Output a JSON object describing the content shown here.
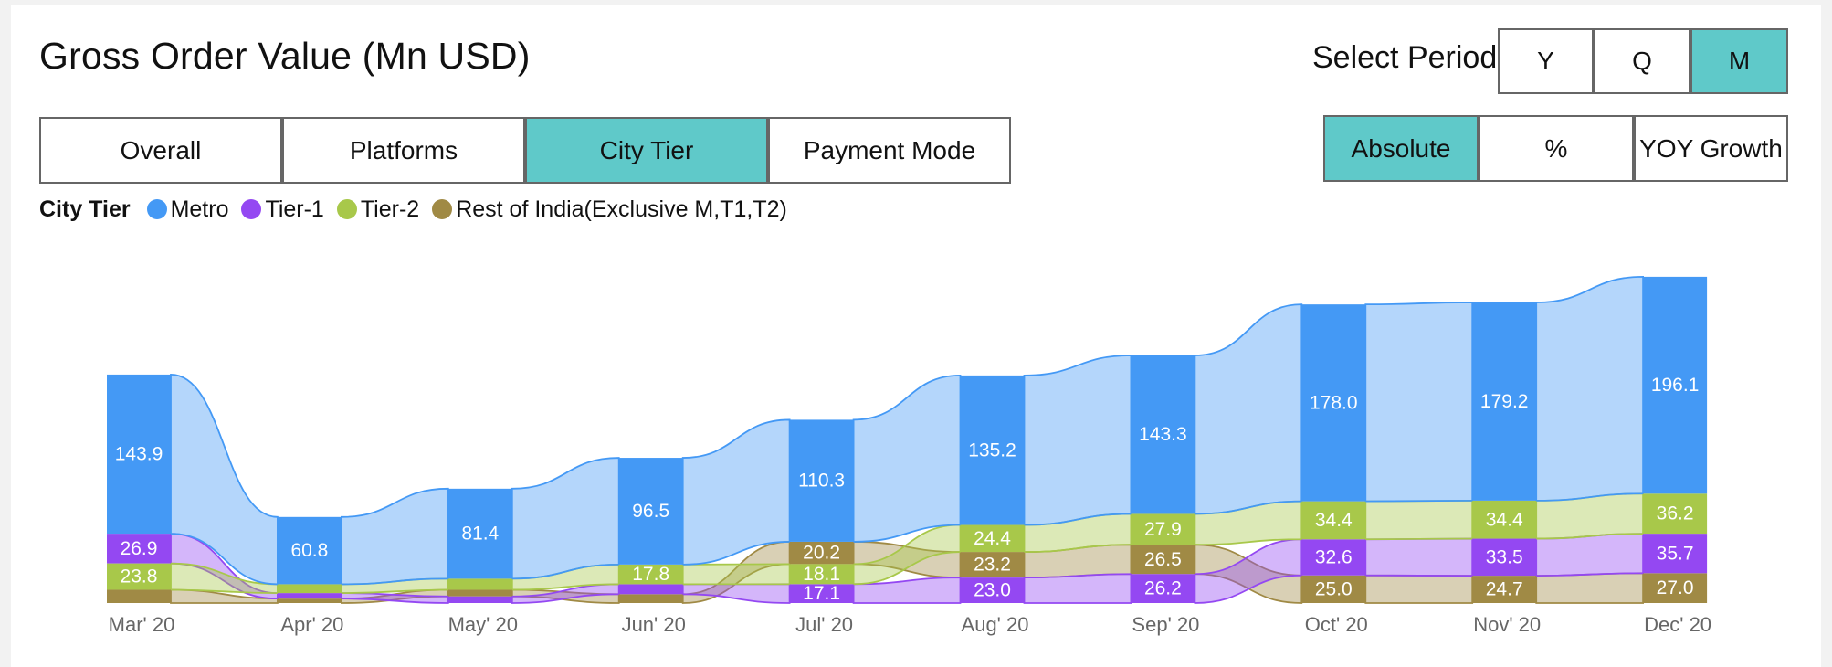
{
  "title": "Gross Order Value (Mn USD)",
  "period": {
    "label": "Select Period",
    "options": [
      "Y",
      "Q",
      "M"
    ],
    "active": "M"
  },
  "tabs": {
    "items": [
      "Overall",
      "Platforms",
      "City Tier",
      "Payment Mode"
    ],
    "active": "City Tier"
  },
  "modes": {
    "items": [
      "Absolute",
      "%",
      "YOY Growth"
    ],
    "active": "Absolute"
  },
  "legend": {
    "title": "City Tier"
  },
  "colors": {
    "metro": "#4499f5",
    "tier1": "#9448f2",
    "tier2": "#a8c84a",
    "rest": "#a08a45",
    "active_button": "#5fc9c9"
  },
  "chart_data": {
    "type": "bar",
    "stacked": true,
    "ribbons_between_bars": true,
    "categories": [
      "Mar' 20",
      "Apr' 20",
      "May' 20",
      "Jun' 20",
      "Jul' 20",
      "Aug' 20",
      "Sep' 20",
      "Oct' 20",
      "Nov' 20",
      "Dec' 20"
    ],
    "series": [
      {
        "name": "Rest of India(Exclusive M,T1,T2)",
        "values": [
          12.0,
          4.0,
          6.0,
          8.0,
          20.2,
          23.2,
          26.5,
          25.0,
          24.7,
          27.0
        ],
        "labels": [
          "",
          "",
          "",
          "",
          "20.2",
          "23.2",
          "26.5",
          "25.0",
          "24.7",
          "27.0"
        ]
      },
      {
        "name": "Tier-2",
        "values": [
          23.8,
          8.0,
          10.0,
          17.8,
          18.1,
          24.4,
          27.9,
          34.4,
          34.4,
          36.2
        ],
        "labels": [
          "23.8",
          "",
          "",
          "17.8",
          "18.1",
          "24.4",
          "27.9",
          "34.4",
          "34.4",
          "36.2"
        ]
      },
      {
        "name": "Tier-1",
        "values": [
          26.9,
          5.0,
          6.0,
          9.0,
          17.1,
          23.0,
          26.2,
          32.6,
          33.5,
          35.7
        ],
        "labels": [
          "26.9",
          "",
          "",
          "",
          "17.1",
          "23.0",
          "26.2",
          "32.6",
          "33.5",
          "35.7"
        ]
      },
      {
        "name": "Metro",
        "values": [
          143.9,
          60.8,
          81.4,
          96.5,
          110.3,
          135.2,
          143.3,
          178.0,
          179.2,
          196.1
        ],
        "labels": [
          "143.9",
          "60.8",
          "81.4",
          "96.5",
          "110.3",
          "135.2",
          "143.3",
          "178.0",
          "179.2",
          "196.1"
        ]
      }
    ],
    "tier_order_bottom_to_top": [
      [
        "Rest of India(Exclusive M,T1,T2)",
        "Tier-2",
        "Tier-1",
        "Metro"
      ],
      [
        "Rest of India(Exclusive M,T1,T2)",
        "Tier-1",
        "Tier-2",
        "Metro"
      ],
      [
        "Tier-1",
        "Rest of India(Exclusive M,T1,T2)",
        "Tier-2",
        "Metro"
      ],
      [
        "Rest of India(Exclusive M,T1,T2)",
        "Tier-1",
        "Tier-2",
        "Metro"
      ],
      [
        "Tier-1",
        "Tier-2",
        "Rest of India(Exclusive M,T1,T2)",
        "Metro"
      ],
      [
        "Tier-1",
        "Rest of India(Exclusive M,T1,T2)",
        "Tier-2",
        "Metro"
      ],
      [
        "Tier-1",
        "Rest of India(Exclusive M,T1,T2)",
        "Tier-2",
        "Metro"
      ],
      [
        "Rest of India(Exclusive M,T1,T2)",
        "Tier-1",
        "Tier-2",
        "Metro"
      ],
      [
        "Rest of India(Exclusive M,T1,T2)",
        "Tier-1",
        "Tier-2",
        "Metro"
      ],
      [
        "Rest of India(Exclusive M,T1,T2)",
        "Tier-1",
        "Tier-2",
        "Metro"
      ]
    ],
    "ylim": [
      0,
      380
    ],
    "xlabel": "",
    "ylabel": "",
    "grid": false,
    "legend_position": "top-left"
  }
}
